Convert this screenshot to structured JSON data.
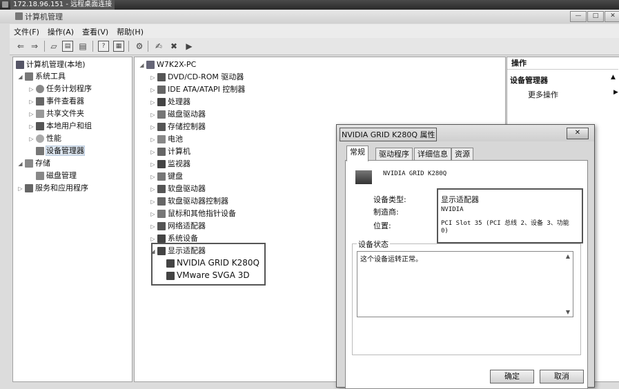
{
  "rdp": {
    "title": "172.18.96.151 - 远程桌面连接"
  },
  "window": {
    "title": "计算机管理"
  },
  "menu": {
    "file": "文件(F)",
    "action": "操作(A)",
    "view": "查看(V)",
    "help": "帮助(H)"
  },
  "left_tree": {
    "root": "计算机管理(本地)",
    "system_tools": "系统工具",
    "task_scheduler": "任务计划程序",
    "event_viewer": "事件查看器",
    "shared_folders": "共享文件夹",
    "local_users": "本地用户和组",
    "performance": "性能",
    "device_manager": "设备管理器",
    "storage": "存储",
    "disk_management": "磁盘管理",
    "services": "服务和应用程序"
  },
  "device_tree": {
    "computer": "W7K2X-PC",
    "categories": [
      "DVD/CD-ROM 驱动器",
      "IDE ATA/ATAPI 控制器",
      "处理器",
      "磁盘驱动器",
      "存储控制器",
      "电池",
      "计算机",
      "监视器",
      "键盘",
      "软盘驱动器",
      "软盘驱动器控制器",
      "鼠标和其他指针设备",
      "网络适配器",
      "系统设备"
    ],
    "display_adapters": "显示适配器",
    "adapters": [
      "NVIDIA GRID K280Q",
      "VMware SVGA 3D"
    ]
  },
  "actions": {
    "header": "操作",
    "section": "设备管理器",
    "more": "更多操作"
  },
  "dialog": {
    "title": "NVIDIA GRID K280Q 属性",
    "tabs": [
      "常规",
      "驱动程序",
      "详细信息",
      "资源"
    ],
    "device_name": "NVIDIA GRID K280Q",
    "type_label": "设备类型:",
    "type_value": "显示适配器",
    "mfr_label": "制造商:",
    "mfr_value": "NVIDIA",
    "loc_label": "位置:",
    "loc_value": "PCI Slot 35 (PCI 总线 2、设备 3、功能 0)",
    "status_legend": "设备状态",
    "status_text": "这个设备运转正常。",
    "ok": "确定",
    "cancel": "取消"
  }
}
